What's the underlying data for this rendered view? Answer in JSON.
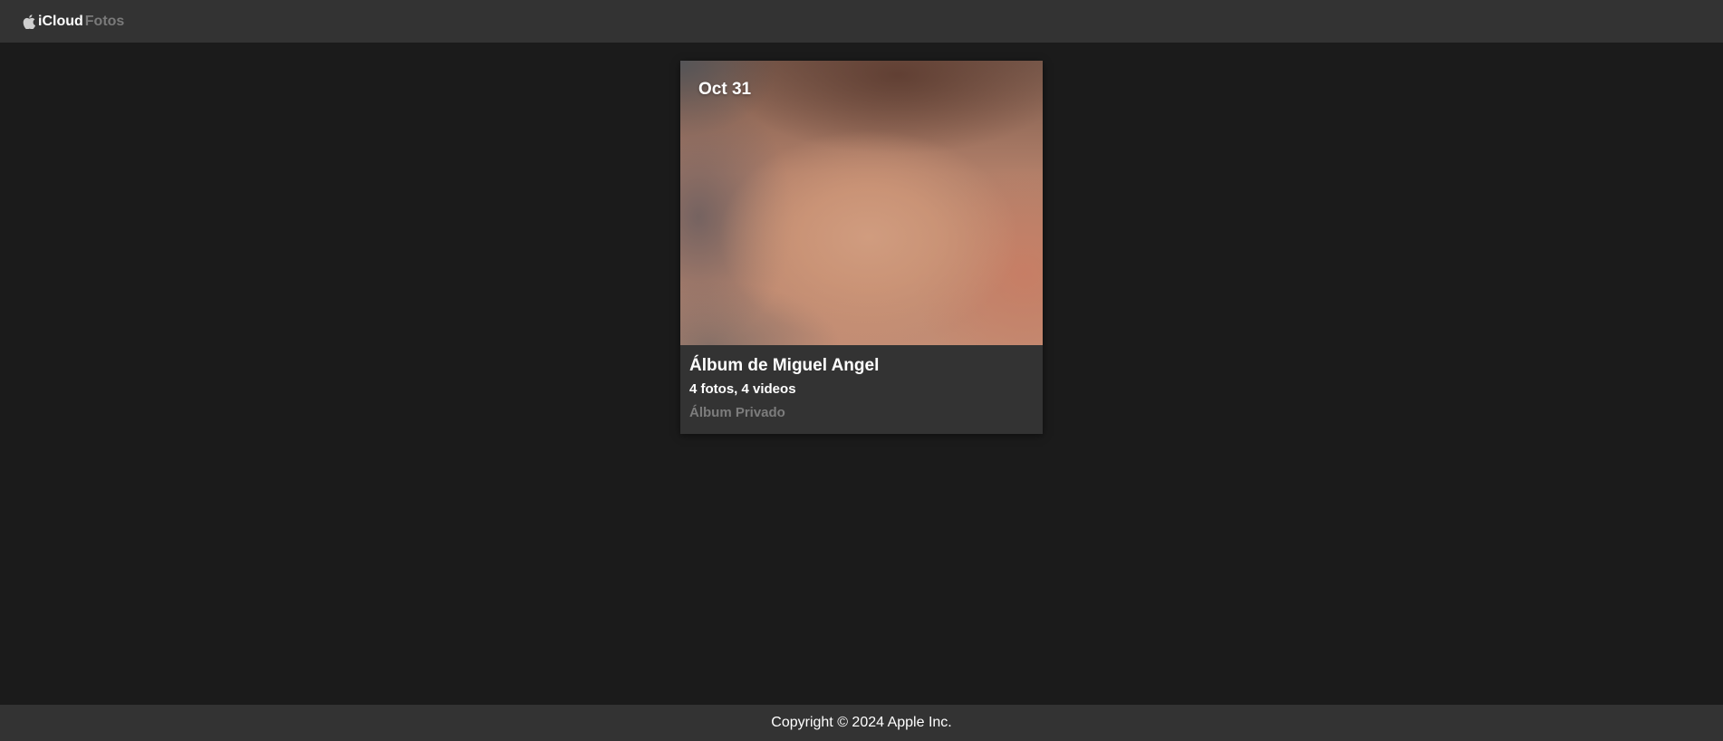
{
  "header": {
    "logo_icon": "apple-icon",
    "brand_primary": "iCloud",
    "brand_secondary": "Fotos",
    "colors": {
      "background": "#333333",
      "primary_text": "#ffffff",
      "secondary_text": "#7a7a7a"
    }
  },
  "album": {
    "date_label": "Oct 31",
    "title": "Álbum de Miguel Angel",
    "count": "4 fotos, 4 videos",
    "privacy": "Álbum Privado"
  },
  "footer": {
    "copyright": "Copyright © 2024 Apple Inc."
  },
  "colors": {
    "page_background": "#1b1b1b",
    "card_background": "#333333",
    "muted_text": "#7c7c7c"
  }
}
